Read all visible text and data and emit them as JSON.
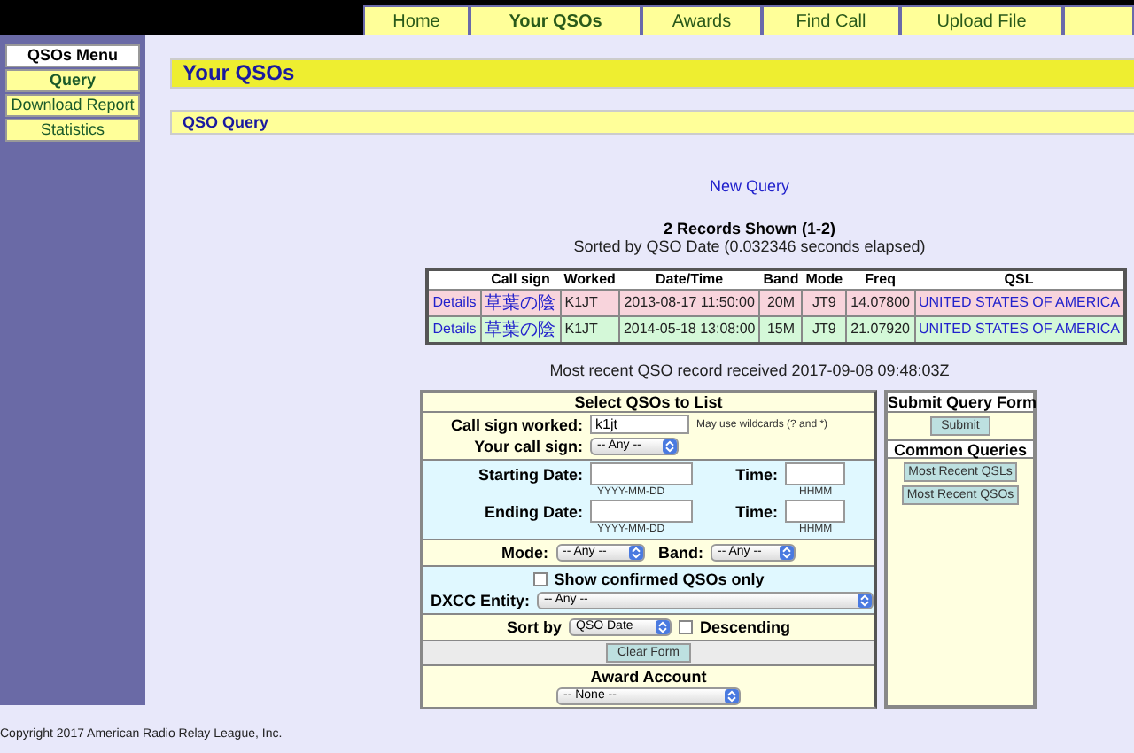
{
  "nav": [
    {
      "label": "Home",
      "selected": false
    },
    {
      "label": "Your QSOs",
      "selected": true
    },
    {
      "label": "Awards",
      "selected": false
    },
    {
      "label": "Find Call",
      "selected": false
    },
    {
      "label": "Upload File",
      "selected": false
    }
  ],
  "sidebar": {
    "title": "QSOs Menu",
    "items": [
      {
        "label": "Query",
        "selected": true
      },
      {
        "label": "Download Report",
        "selected": false
      },
      {
        "label": "Statistics",
        "selected": false
      }
    ]
  },
  "page_title": "Your QSOs",
  "section_title": "QSO Query",
  "new_query": "New Query",
  "summary": "2 Records Shown (1-2)",
  "sorted_note": "Sorted by QSO Date (0.032346 seconds elapsed)",
  "table": {
    "columns": [
      "",
      "Call sign",
      "Worked",
      "Date/Time",
      "Band",
      "Mode",
      "Freq",
      "QSL"
    ],
    "rows": [
      {
        "color": "#f8d4dc",
        "cells": [
          "Details",
          "草葉の陰",
          "K1JT",
          "2013-08-17 11:50:00",
          "20M",
          "JT9",
          "14.07800",
          "UNITED STATES OF AMERICA"
        ]
      },
      {
        "color": "#d4f8d8",
        "cells": [
          "Details",
          "草葉の陰",
          "K1JT",
          "2014-05-18 13:08:00",
          "15M",
          "JT9",
          "21.07920",
          "UNITED STATES OF AMERICA"
        ]
      }
    ]
  },
  "recent_note": "Most recent QSO record received 2017-09-08 09:48:03Z",
  "form": {
    "title": "Select QSOs to List",
    "call_sign_worked": {
      "label": "Call sign worked:",
      "value": "k1jt",
      "hint": "May use wildcards (? and *)"
    },
    "your_call_sign": {
      "label": "Your call sign:",
      "value": "-- Any --"
    },
    "starting": {
      "label": "Starting Date:",
      "hint": "YYYY-MM-DD",
      "time_label": "Time:",
      "time_hint": "HHMM"
    },
    "ending": {
      "label": "Ending Date:",
      "hint": "YYYY-MM-DD",
      "time_label": "Time:",
      "time_hint": "HHMM"
    },
    "mode": {
      "label": "Mode:",
      "value": "-- Any --"
    },
    "band": {
      "label": "Band:",
      "value": "-- Any --"
    },
    "confirmed_only": {
      "label": "Show confirmed QSOs only",
      "checked": false
    },
    "dxcc": {
      "label": "DXCC Entity:",
      "value": "-- Any --"
    },
    "sort_by": {
      "label": "Sort by",
      "value": "QSO Date"
    },
    "descending": {
      "label": "Descending",
      "checked": false
    },
    "clear_button": "Clear Form",
    "award_account": {
      "label": "Award Account",
      "value": "-- None --"
    }
  },
  "side_form": {
    "title": "Submit Query Form",
    "submit": "Submit",
    "common_title": "Common Queries",
    "buttons": [
      "Most Recent QSLs",
      "Most Recent QSOs"
    ]
  },
  "footer": "Copyright 2017 American Radio Relay League, Inc."
}
